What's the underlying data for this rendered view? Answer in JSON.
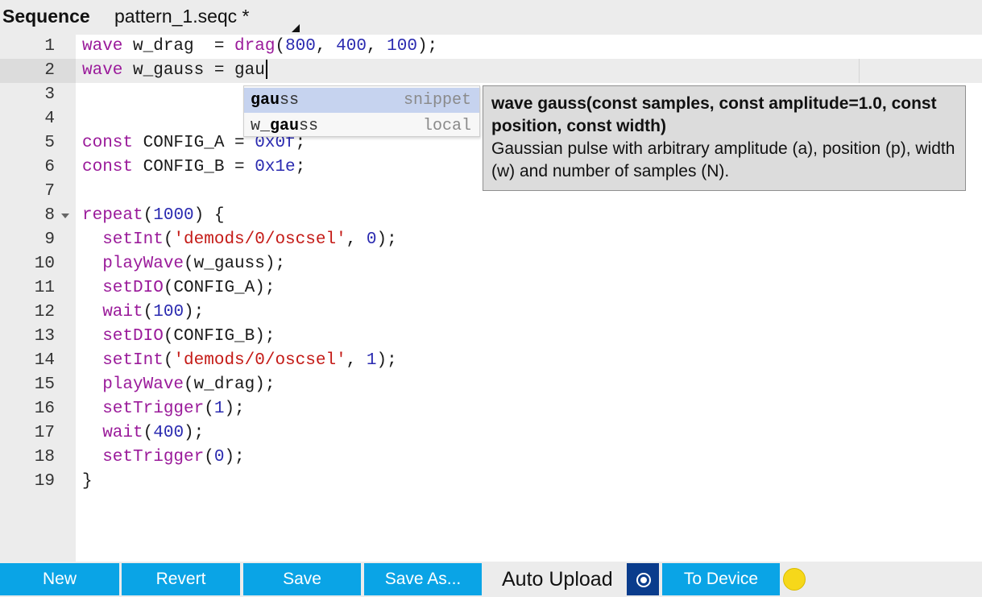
{
  "title": {
    "label": "Sequence",
    "filename": "pattern_1.seqc *"
  },
  "editor": {
    "lines": [
      {
        "num": "1"
      },
      {
        "num": "2"
      },
      {
        "num": "3"
      },
      {
        "num": "4"
      },
      {
        "num": "5"
      },
      {
        "num": "6"
      },
      {
        "num": "7"
      },
      {
        "num": "8"
      },
      {
        "num": "9"
      },
      {
        "num": "10"
      },
      {
        "num": "11"
      },
      {
        "num": "12"
      },
      {
        "num": "13"
      },
      {
        "num": "14"
      },
      {
        "num": "15"
      },
      {
        "num": "16"
      },
      {
        "num": "17"
      },
      {
        "num": "18"
      },
      {
        "num": "19"
      }
    ],
    "code": {
      "l1": {
        "kw": "wave",
        "a": " w_drag  = ",
        "fn": "drag",
        "b": "(",
        "n1": "800",
        "c": ", ",
        "n2": "400",
        "d": ", ",
        "n3": "100",
        "e": ");"
      },
      "l2": {
        "kw": "wave",
        "a": " w_gauss = gau"
      },
      "l5": {
        "kw": "const",
        "a": " CONFIG_A = ",
        "n1": "0x0f",
        "b": ";"
      },
      "l6": {
        "kw": "const",
        "a": " CONFIG_B = ",
        "n1": "0x1e",
        "b": ";"
      },
      "l8": {
        "kw": "repeat",
        "a": "(",
        "n1": "1000",
        "b": ") {"
      },
      "l9": {
        "fn": "  setInt",
        "a": "(",
        "s": "'demods/0/oscsel'",
        "b": ", ",
        "n1": "0",
        "c": ");"
      },
      "l10": {
        "fn": "  playWave",
        "a": "(w_gauss);"
      },
      "l11": {
        "fn": "  setDIO",
        "a": "(CONFIG_A);"
      },
      "l12": {
        "fn": "  wait",
        "a": "(",
        "n1": "100",
        "b": ");"
      },
      "l13": {
        "fn": "  setDIO",
        "a": "(CONFIG_B);"
      },
      "l14": {
        "fn": "  setInt",
        "a": "(",
        "s": "'demods/0/oscsel'",
        "b": ", ",
        "n1": "1",
        "c": ");"
      },
      "l15": {
        "fn": "  playWave",
        "a": "(w_drag);"
      },
      "l16": {
        "fn": "  setTrigger",
        "a": "(",
        "n1": "1",
        "b": ");"
      },
      "l17": {
        "fn": "  wait",
        "a": "(",
        "n1": "400",
        "b": ");"
      },
      "l18": {
        "fn": "  setTrigger",
        "a": "(",
        "n1": "0",
        "b": ");"
      },
      "l19": {
        "a": "}"
      }
    }
  },
  "autocomplete": {
    "items": [
      {
        "prefix": "",
        "match": "gau",
        "rest": "ss",
        "meta": "snippet",
        "selected": true
      },
      {
        "prefix": "w_",
        "match": "gau",
        "rest": "ss",
        "meta": "local",
        "selected": false
      }
    ]
  },
  "tooltip": {
    "signature": "wave gauss(const samples, const amplitude=1.0, const position, const width)",
    "description": "Gaussian pulse with arbitrary amplitude (a), position (p), width (w) and number of samples (N)."
  },
  "toolbar": {
    "new_label": "New",
    "revert_label": "Revert",
    "save_label": "Save",
    "save_as_label": "Save As...",
    "auto_upload_label": "Auto Upload",
    "to_device_label": "To Device"
  },
  "colors": {
    "button_bg": "#0aa4e6",
    "toggle_bg": "#0a3c8c",
    "status_led": "#f6d81a",
    "keyword": "#9a1a9a",
    "number": "#2a2ab0",
    "string": "#c41a16"
  },
  "icons": {
    "fold": "fold-arrow-icon",
    "toggle": "radio-toggle-icon",
    "status": "status-indicator-icon"
  }
}
